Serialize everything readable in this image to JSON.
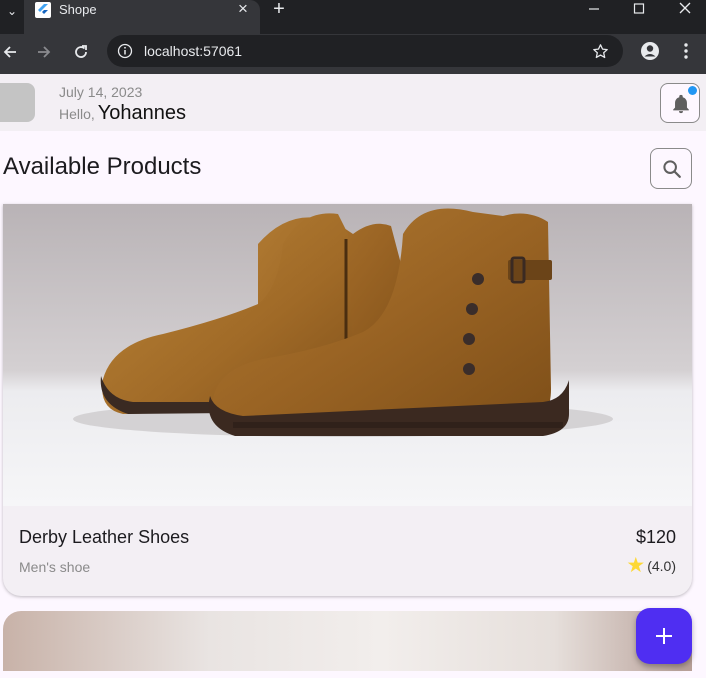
{
  "browser": {
    "tab_title": "Shope",
    "url": "localhost:57061"
  },
  "header": {
    "date": "July 14, 2023",
    "greeting": "Hello,",
    "user_name": "Yohannes"
  },
  "section": {
    "title": "Available Products"
  },
  "products": [
    {
      "name": "Derby Leather Shoes",
      "price": "$120",
      "category": "Men's shoe",
      "rating": "(4.0)"
    }
  ],
  "colors": {
    "fab": "#4f2ef2",
    "notification_dot": "#2196f3",
    "card_divider": "#4caf50",
    "star": "#fdd835"
  },
  "icons": {
    "tab_search": "chevron-down-icon",
    "new_tab": "plus-icon",
    "notification": "bell-icon",
    "search": "search-icon",
    "fab": "plus-icon",
    "rating": "star-icon"
  }
}
